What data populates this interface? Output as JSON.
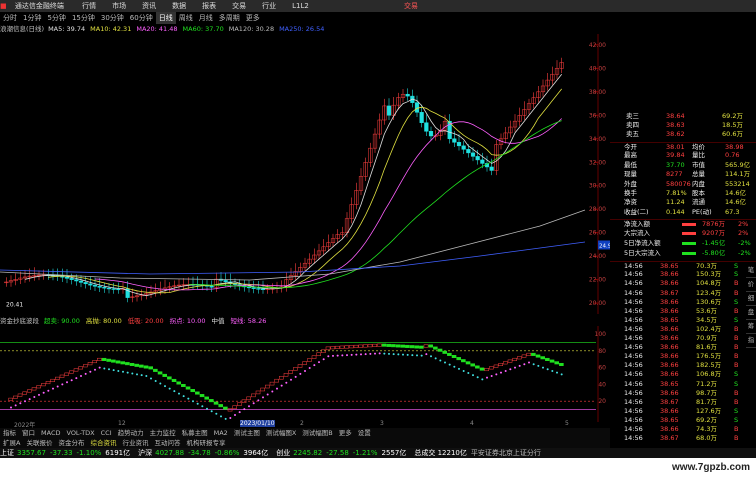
{
  "titlebar": {
    "app": "通达信金融终端",
    "menus": [
      "行情",
      "市场",
      "资讯",
      "数据",
      "报表",
      "交易",
      "行业",
      "L1L2"
    ],
    "right": "交易"
  },
  "period_tabs": [
    "分时",
    "1分钟",
    "5分钟",
    "15分钟",
    "30分钟",
    "60分钟",
    "日线",
    "周线",
    "月线",
    "多周期",
    "更多"
  ],
  "active_period": "日线",
  "ma_bar": {
    "name": "浪潮信息(日线)",
    "items": [
      {
        "label": "MA5: 39.74",
        "color": "#e0e0e0"
      },
      {
        "label": "MA10: 42.31",
        "color": "#e0e040"
      },
      {
        "label": "MA20: 41.48",
        "color": "#ff60ff"
      },
      {
        "label": "MA60: 37.70",
        "color": "#20e020"
      },
      {
        "label": "MA120: 30.28",
        "color": "#bbbbbb"
      },
      {
        "label": "MA250: 26.54",
        "color": "#4060ff"
      }
    ]
  },
  "price_axis": [
    "42.00",
    "40.00",
    "38.00",
    "36.00",
    "34.00",
    "32.00",
    "30.00",
    "28.00",
    "26.00",
    "24.00",
    "22.00",
    "20.00"
  ],
  "price_labels": {
    "low": "20.41",
    "mark": "24.91"
  },
  "indicator_bar": {
    "name": "资金抄底波段",
    "items": [
      {
        "label": "超卖: 90.00",
        "color": "#20e020"
      },
      {
        "label": "高抛: 80.00",
        "color": "#e0e040"
      },
      {
        "label": "低吸: 20.00",
        "color": "#ff4040"
      },
      {
        "label": "拐点: 10.00",
        "color": "#ff60ff"
      },
      {
        "label": "中值",
        "color": "#e0e0e0"
      },
      {
        "label": "短线: 58.26",
        "color": "#ff60ff"
      }
    ]
  },
  "sub_axis": [
    "100",
    "80",
    "60",
    "40",
    "20"
  ],
  "dates": [
    "2022年",
    "12",
    "2023/01/10",
    "2",
    "3",
    "4",
    "5"
  ],
  "bottom_tabs": [
    "指标",
    "窗口",
    "MACD",
    "VOL-TDX",
    "CCI",
    "趋势动力",
    "主力监控",
    "私募主图",
    "MA2",
    "测试主图",
    "测试幅图X",
    "测试幅图B",
    "更多",
    "设置"
  ],
  "bottom_tabs2": [
    "扩展A",
    "关联报价",
    "资金分布",
    "综合资讯",
    "行业资讯",
    "互动问答",
    "机构研报专享"
  ],
  "statusbar": {
    "items": [
      {
        "label": "上证",
        "value": "3357.67",
        "chg": "-37.33",
        "pct": "-1.10%",
        "amt": "6191亿"
      },
      {
        "label": "沪深",
        "value": "4027.88",
        "chg": "-34.78",
        "pct": "-0.86%",
        "amt": "3964亿"
      },
      {
        "label": "创业",
        "value": "2245.82",
        "chg": "-27.58",
        "pct": "-1.21%",
        "amt": "2557亿"
      }
    ],
    "extra": "总成交 12210亿",
    "tail": "平安证券北京上证分行"
  },
  "watermark": "www.7gpzb.com",
  "quote_panel": {
    "order_book": [
      {
        "label": "卖三",
        "price": "38.64",
        "vol": "69.2万"
      },
      {
        "label": "卖四",
        "price": "38.63",
        "vol": "18.5万"
      },
      {
        "label": "卖五",
        "price": "38.62",
        "vol": "60.6万"
      }
    ],
    "stats": [
      {
        "l1": "今开",
        "v1": "38.01",
        "l2": "均价",
        "v2": "38.98"
      },
      {
        "l1": "最高",
        "v1": "39.84",
        "l2": "量比",
        "v2": "0.76"
      },
      {
        "l1": "最低",
        "v1": "37.70",
        "l2": "市值",
        "v2": "565.9亿"
      },
      {
        "l1": "现量",
        "v1": "8277",
        "l2": "总量",
        "v2": "114.1万"
      },
      {
        "l1": "外盘",
        "v1": "580076",
        "l2": "内盘",
        "v2": "553214"
      },
      {
        "l1": "换手",
        "v1": "7.81%",
        "l2": "股本",
        "v2": "14.6亿"
      },
      {
        "l1": "净资",
        "v1": "11.24",
        "l2": "流通",
        "v2": "14.6亿"
      },
      {
        "l1": "收益(二)",
        "v1": "0.144",
        "l2": "PE(动)",
        "v2": "67.3"
      }
    ],
    "flows": [
      {
        "label": "净流入额",
        "value": "7876万",
        "pct": "2%",
        "color": "#ff4040"
      },
      {
        "label": "大宗流入",
        "value": "9207万",
        "pct": "2%",
        "color": "#ff4040"
      },
      {
        "label": "5日净流入额",
        "value": "-1.45亿",
        "pct": "-2%",
        "color": "#20e020"
      },
      {
        "label": "5日大宗流入",
        "value": "-5.80亿",
        "pct": "-2%",
        "color": "#20e020"
      }
    ],
    "ticks": [
      {
        "t": "14:56",
        "p": "38.65",
        "v": "70.3万",
        "s": "S"
      },
      {
        "t": "14:56",
        "p": "38.66",
        "v": "150.3万",
        "s": "S"
      },
      {
        "t": "14:56",
        "p": "38.66",
        "v": "104.8万",
        "s": "B"
      },
      {
        "t": "14:56",
        "p": "38.67",
        "v": "123.4万",
        "s": "B"
      },
      {
        "t": "14:56",
        "p": "38.66",
        "v": "130.6万",
        "s": "S"
      },
      {
        "t": "14:56",
        "p": "38.66",
        "v": "53.6万",
        "s": "B"
      },
      {
        "t": "14:56",
        "p": "38.65",
        "v": "34.5万",
        "s": "S"
      },
      {
        "t": "14:56",
        "p": "38.66",
        "v": "102.4万",
        "s": "B"
      },
      {
        "t": "14:56",
        "p": "38.66",
        "v": "70.9万",
        "s": "B"
      },
      {
        "t": "14:56",
        "p": "38.66",
        "v": "81.6万",
        "s": "B"
      },
      {
        "t": "14:56",
        "p": "38.66",
        "v": "176.5万",
        "s": "B"
      },
      {
        "t": "14:56",
        "p": "38.66",
        "v": "182.5万",
        "s": "B"
      },
      {
        "t": "14:56",
        "p": "38.66",
        "v": "106.8万",
        "s": "S"
      },
      {
        "t": "14:56",
        "p": "38.65",
        "v": "71.2万",
        "s": "S"
      },
      {
        "t": "14:56",
        "p": "38.66",
        "v": "98.7万",
        "s": "B"
      },
      {
        "t": "14:56",
        "p": "38.67",
        "v": "81.7万",
        "s": "B"
      },
      {
        "t": "14:56",
        "p": "38.66",
        "v": "127.6万",
        "s": "S"
      },
      {
        "t": "14:56",
        "p": "38.65",
        "v": "69.2万",
        "s": "S"
      },
      {
        "t": "14:56",
        "p": "38.66",
        "v": "74.3万",
        "s": "B"
      },
      {
        "t": "14:56",
        "p": "38.67",
        "v": "68.0万",
        "s": "B"
      },
      {
        "t": "14:56",
        "p": "38.66",
        "v": "84.2万",
        "s": "S"
      },
      {
        "t": "14:56",
        "p": "38.66",
        "v": "60.2万",
        "s": "B"
      }
    ],
    "tabs": [
      "笔",
      "价",
      "细",
      "盘",
      "筹",
      "指"
    ]
  },
  "colors": {
    "up": "#ff4040",
    "down": "#20e0e0",
    "bg": "#000000"
  }
}
